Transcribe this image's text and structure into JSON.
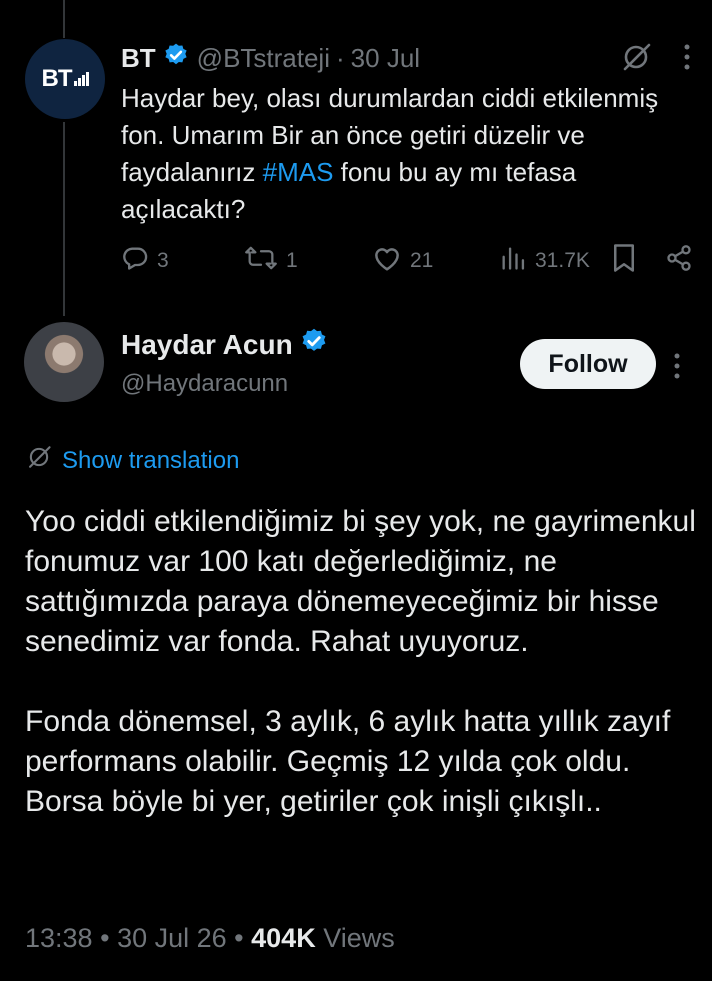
{
  "reply": {
    "avatar_logo": "BT",
    "name": "BT",
    "handle": "@BTstrateji",
    "separator": "·",
    "date": "30 Jul",
    "text_before": "Haydar bey, olası durumlardan ciddi etkilenmiş fon.  Umarım Bir an önce getiri düzelir ve faydalanırız ",
    "hashtag": "#MAS",
    "text_after": " fonu bu ay mı tefasa açılacaktı?",
    "replies": "3",
    "reposts": "1",
    "likes": "21",
    "views": "31.7K"
  },
  "main": {
    "name": "Haydar Acun",
    "handle": "@Haydaracunn",
    "follow_label": "Follow",
    "show_translation": "Show translation",
    "text": "Yoo ciddi etkilendiğimiz bi şey yok, ne gayrimenkul fonumuz var 100 katı değerlediğimiz, ne sattığımızda paraya dönemeyeceğimiz bir hisse senedimiz var fonda. Rahat uyuyoruz.\n\nFonda dönemsel, 3 aylık, 6 aylık hatta yıllık zayıf performans olabilir. Geçmiş 12 yılda çok oldu. Borsa böyle bi yer, getiriler çok inişli çıkışlı..",
    "time": "13:38",
    "dot": "•",
    "date": "30 Jul 26",
    "views_count": "404K",
    "views_label": "Views"
  },
  "colors": {
    "accent": "#1d9bf0",
    "muted": "#71767b",
    "text": "#e7e9ea",
    "background": "#000000"
  }
}
